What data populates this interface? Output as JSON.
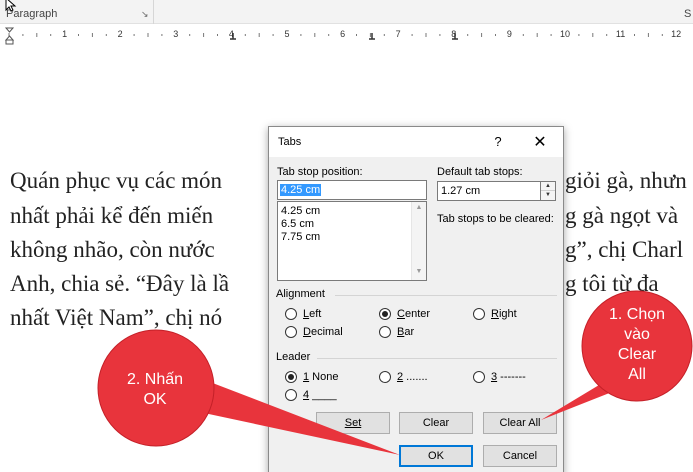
{
  "ribbon": {
    "group_label": "Paragraph",
    "launcher": "↘",
    "right_label": "S"
  },
  "ruler": {
    "labels": [
      "1",
      "2",
      "3",
      "4",
      "5",
      "6",
      "7",
      "8",
      "9",
      "10",
      "11",
      "12"
    ]
  },
  "document": {
    "lines": [
      "Quán phục vụ các món",
      "nhất phải kể đến miến",
      "không nhão, còn nước",
      "Anh, chia sẻ. “Đây là lầ",
      "nhất Việt Nam”, chị nó"
    ],
    "right_fragments": [
      "giỏi gà, nhưn",
      "g gà ngọt và",
      "g”, chị Charl",
      "g tôi từ đa",
      ""
    ]
  },
  "dialog": {
    "title": "Tabs",
    "help": "?",
    "close": "✕",
    "tab_stop_position_label": "Tab stop position:",
    "tab_stop_position_value": "4.25 cm",
    "tab_stops": [
      "4.25 cm",
      "6.5 cm",
      "7.75 cm"
    ],
    "default_tab_stops_label": "Default tab stops:",
    "default_tab_stops_value": "1.27 cm",
    "to_be_cleared_label": "Tab stops to be cleared:",
    "alignment": {
      "label": "Alignment",
      "options": [
        "Left",
        "Center",
        "Right",
        "Decimal",
        "Bar"
      ],
      "selected": "Center"
    },
    "leader": {
      "label": "Leader",
      "options": [
        "1 None",
        "2 .......",
        "3 -------",
        "4 ____"
      ],
      "selected": "1 None"
    },
    "buttons": {
      "set": "Set",
      "clear": "Clear",
      "clear_all": "Clear All",
      "ok": "OK",
      "cancel": "Cancel"
    }
  },
  "callouts": {
    "step1": "1. Chọn vào Clear All",
    "step1_lines": [
      "1. Chọn",
      "vào",
      "Clear",
      "All"
    ],
    "step2_lines": [
      "2. Nhấn",
      "OK"
    ],
    "color": "#e8343c"
  },
  "colors": {
    "selection": "#3399ff",
    "default_button_border": "#0078d7",
    "callout": "#e8343c"
  }
}
